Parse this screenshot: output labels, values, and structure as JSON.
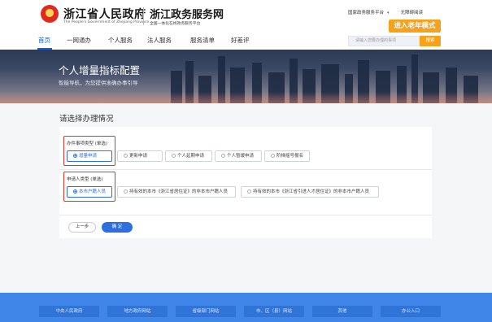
{
  "header": {
    "gov_title": "浙江省人民政府",
    "gov_subtitle": "The People's Government of Zhejiang Province",
    "service_title": "浙江政务服务网",
    "service_subtitle": "全国一体化在线政务服务平台",
    "platform_link": "国家政务服务平台",
    "accessible_link": "无障碍阅读",
    "elder_mode": "进入老年模式"
  },
  "nav": {
    "items": [
      "首页",
      "一网通办",
      "个人服务",
      "法人服务",
      "服务清单",
      "好差评"
    ],
    "active_index": 0,
    "search_placeholder": "请输入您要办理的事项",
    "search_button": "搜索"
  },
  "banner": {
    "title": "个人增量指标配置",
    "subtitle": "智能导航，为您提供准确办事引导"
  },
  "form": {
    "heading": "请选择办理情况",
    "group1": {
      "label": "办件事项类型 (单选)",
      "options": [
        "增量申请",
        "更新申请",
        "个人延期申请",
        "个人暂缓申请",
        "阶梯摇号报名"
      ],
      "selected_index": 0
    },
    "group2": {
      "label": "申请人类型 (单选)",
      "options": [
        "本市户籍人员",
        "持有效的本市《浙江省居住证》的非本市户籍人员",
        "持有效的本市《浙江省引进人才居住证》的非本市户籍人员"
      ],
      "selected_index": 0
    },
    "prev_button": "上一步",
    "confirm_button": "确 定"
  },
  "footer": {
    "links": [
      "中央人民政府",
      "地方政府网站",
      "省级部门网站",
      "市、区（县）网站",
      "其他",
      "办公入口"
    ]
  },
  "colors": {
    "primary_blue": "#2d6fe0",
    "accent_orange": "#f7a21b",
    "highlight_red": "#e0362a",
    "footer_blue": "#3f86e8"
  }
}
